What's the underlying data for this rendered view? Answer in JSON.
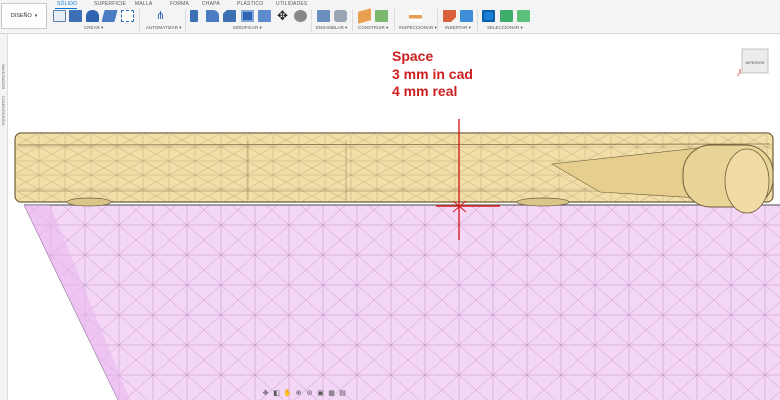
{
  "toolbar": {
    "design_button": "DISEÑO",
    "tabs": [
      {
        "label": "SÓLIDO",
        "active": true
      },
      {
        "label": "SUPERFICIE",
        "active": false
      },
      {
        "label": "MALLA",
        "active": false
      },
      {
        "label": "FORMA",
        "active": false
      },
      {
        "label": "CHAPA",
        "active": false
      },
      {
        "label": "PLÁSTICO",
        "active": false
      },
      {
        "label": "UTILIDADES",
        "active": false
      }
    ],
    "groups": {
      "create": "CREAR ▾",
      "automate": "AUTOMATIZAR ▾",
      "modify": "MODIFICAR ▾",
      "assemble": "ENSAMBLAR ▾",
      "construct": "CONSTRUIR ▾",
      "inspect": "INSPECCIONAR ▾",
      "insert": "INSERTAR ▾",
      "select": "SELECCIONAR ▾"
    },
    "accent_color": "#0b77d6"
  },
  "side_panel": {
    "browser": "NAVEGADOR",
    "comments": "COMENTARIOS"
  },
  "annotation": {
    "line1": "Space",
    "line2": "3 mm in cad",
    "line3": "4 mm real",
    "color": "#cc1f1f"
  },
  "viewcube": {
    "face": "INFERIOR",
    "axis": "Z"
  },
  "model": {
    "part_color": "#f2dfa8",
    "base_color": "#f4d6f7"
  }
}
